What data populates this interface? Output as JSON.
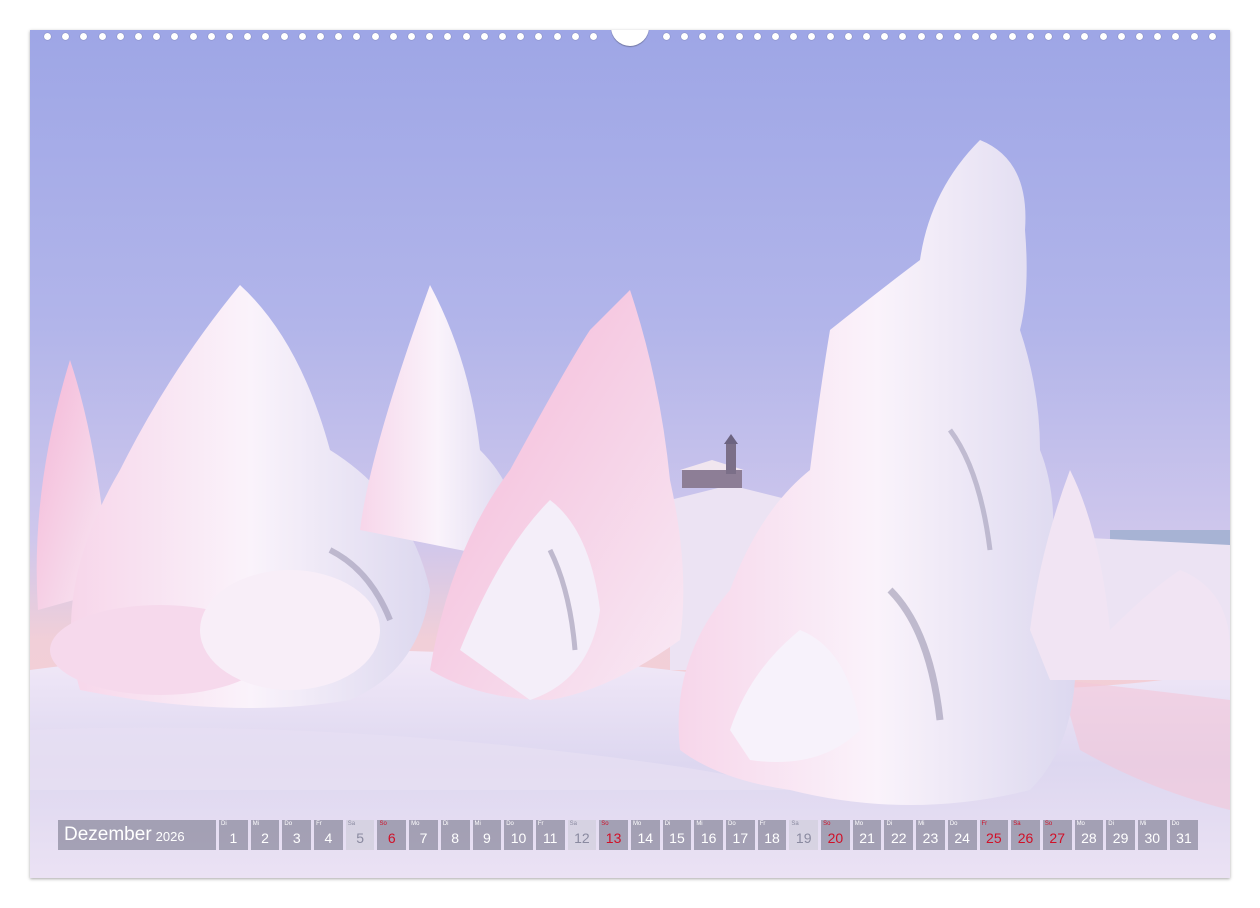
{
  "calendar": {
    "month": "Dezember",
    "year": "2026",
    "days": [
      {
        "wd": "Di",
        "n": "1",
        "type": "work"
      },
      {
        "wd": "Mi",
        "n": "2",
        "type": "work"
      },
      {
        "wd": "Do",
        "n": "3",
        "type": "work"
      },
      {
        "wd": "Fr",
        "n": "4",
        "type": "work"
      },
      {
        "wd": "Sa",
        "n": "5",
        "type": "sat"
      },
      {
        "wd": "So",
        "n": "6",
        "type": "sun"
      },
      {
        "wd": "Mo",
        "n": "7",
        "type": "work"
      },
      {
        "wd": "Di",
        "n": "8",
        "type": "work"
      },
      {
        "wd": "Mi",
        "n": "9",
        "type": "work"
      },
      {
        "wd": "Do",
        "n": "10",
        "type": "work"
      },
      {
        "wd": "Fr",
        "n": "11",
        "type": "work"
      },
      {
        "wd": "Sa",
        "n": "12",
        "type": "sat"
      },
      {
        "wd": "So",
        "n": "13",
        "type": "sun"
      },
      {
        "wd": "Mo",
        "n": "14",
        "type": "work"
      },
      {
        "wd": "Di",
        "n": "15",
        "type": "work"
      },
      {
        "wd": "Mi",
        "n": "16",
        "type": "work"
      },
      {
        "wd": "Do",
        "n": "17",
        "type": "work"
      },
      {
        "wd": "Fr",
        "n": "18",
        "type": "work"
      },
      {
        "wd": "Sa",
        "n": "19",
        "type": "sat"
      },
      {
        "wd": "So",
        "n": "20",
        "type": "sun"
      },
      {
        "wd": "Mo",
        "n": "21",
        "type": "work"
      },
      {
        "wd": "Di",
        "n": "22",
        "type": "work"
      },
      {
        "wd": "Mi",
        "n": "23",
        "type": "work"
      },
      {
        "wd": "Do",
        "n": "24",
        "type": "work"
      },
      {
        "wd": "Fr",
        "n": "25",
        "type": "hol"
      },
      {
        "wd": "Sa",
        "n": "26",
        "type": "hol"
      },
      {
        "wd": "So",
        "n": "27",
        "type": "sun"
      },
      {
        "wd": "Mo",
        "n": "28",
        "type": "work"
      },
      {
        "wd": "Di",
        "n": "29",
        "type": "work"
      },
      {
        "wd": "Mi",
        "n": "30",
        "type": "work"
      },
      {
        "wd": "Do",
        "n": "31",
        "type": "work"
      }
    ]
  },
  "colors": {
    "sky_top": "#9fa6e6",
    "sky_horizon": "#f4c9cf",
    "snow": "#f7f0fb",
    "holiday_red": "#d01028"
  }
}
